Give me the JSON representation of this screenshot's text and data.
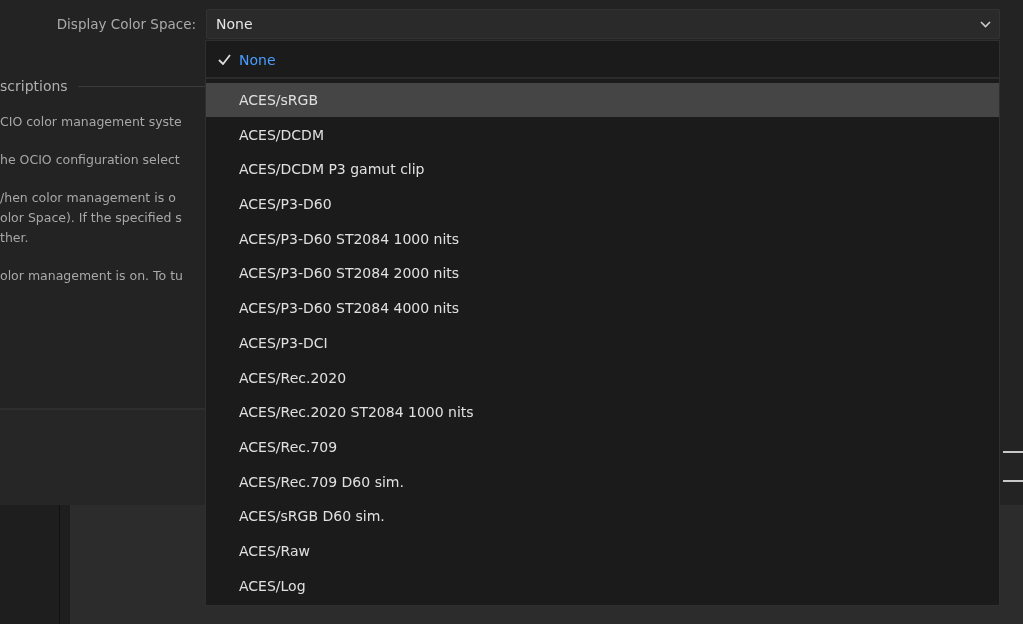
{
  "field": {
    "label": "Display Color Space:",
    "value": "None"
  },
  "description": {
    "heading": "scriptions",
    "paragraphs": [
      [
        "CIO color management syste"
      ],
      [
        "he OCIO configuration select"
      ],
      [
        "/hen color management is o",
        "olor Space). If the specified s",
        "ther."
      ],
      [
        "olor management is on. To tu"
      ]
    ]
  },
  "menu": {
    "items": [
      {
        "label": "None",
        "checked": true,
        "highlighted": false
      },
      {
        "label": "ACES/sRGB",
        "checked": false,
        "highlighted": true
      },
      {
        "label": "ACES/DCDM",
        "checked": false,
        "highlighted": false
      },
      {
        "label": "ACES/DCDM P3 gamut clip",
        "checked": false,
        "highlighted": false
      },
      {
        "label": "ACES/P3-D60",
        "checked": false,
        "highlighted": false
      },
      {
        "label": "ACES/P3-D60 ST2084 1000 nits",
        "checked": false,
        "highlighted": false
      },
      {
        "label": "ACES/P3-D60 ST2084 2000 nits",
        "checked": false,
        "highlighted": false
      },
      {
        "label": "ACES/P3-D60 ST2084 4000 nits",
        "checked": false,
        "highlighted": false
      },
      {
        "label": "ACES/P3-DCI",
        "checked": false,
        "highlighted": false
      },
      {
        "label": "ACES/Rec.2020",
        "checked": false,
        "highlighted": false
      },
      {
        "label": "ACES/Rec.2020 ST2084 1000 nits",
        "checked": false,
        "highlighted": false
      },
      {
        "label": "ACES/Rec.709",
        "checked": false,
        "highlighted": false
      },
      {
        "label": "ACES/Rec.709 D60 sim.",
        "checked": false,
        "highlighted": false
      },
      {
        "label": "ACES/sRGB D60 sim.",
        "checked": false,
        "highlighted": false
      },
      {
        "label": "ACES/Raw",
        "checked": false,
        "highlighted": false
      },
      {
        "label": "ACES/Log",
        "checked": false,
        "highlighted": false
      }
    ]
  }
}
